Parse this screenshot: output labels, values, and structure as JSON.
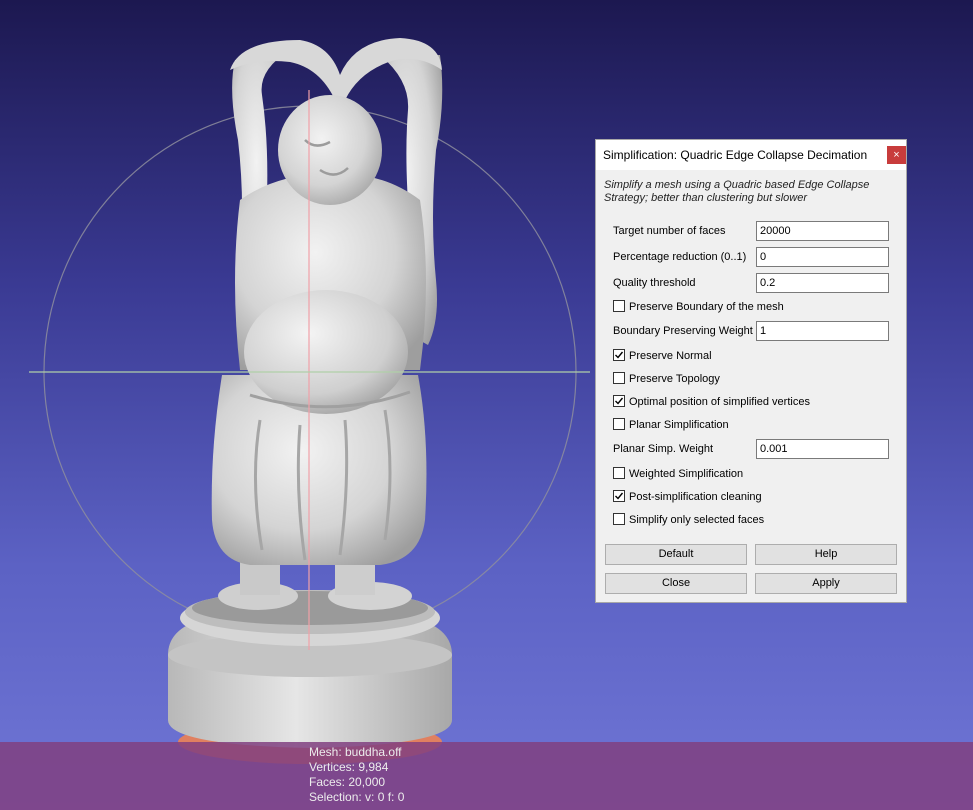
{
  "viewport": {
    "info": {
      "mesh": "Mesh: buddha.off",
      "vertices": "Vertices: 9,984",
      "faces": "Faces: 20,000",
      "selection": "Selection: v: 0 f: 0"
    }
  },
  "dialog": {
    "title": "Simplification: Quadric Edge Collapse Decimation",
    "close_glyph": "×",
    "description": "Simplify a mesh using a Quadric based Edge Collapse Strategy; better than clustering but slower",
    "fields": {
      "target_faces": {
        "label": "Target number of faces",
        "value": "20000"
      },
      "percentage": {
        "label": "Percentage reduction (0..1)",
        "value": "0"
      },
      "quality": {
        "label": "Quality threshold",
        "value": "0.2"
      },
      "boundary_weight": {
        "label": "Boundary Preserving Weight",
        "value": "1"
      },
      "planar_weight": {
        "label": "Planar Simp. Weight",
        "value": "0.001"
      }
    },
    "checks": {
      "preserve_boundary": {
        "label": "Preserve Boundary of the mesh",
        "checked": false
      },
      "preserve_normal": {
        "label": "Preserve Normal",
        "checked": true
      },
      "preserve_topology": {
        "label": "Preserve Topology",
        "checked": false
      },
      "optimal_position": {
        "label": "Optimal position of simplified vertices",
        "checked": true
      },
      "planar_simplification": {
        "label": "Planar Simplification",
        "checked": false
      },
      "weighted_simplification": {
        "label": "Weighted Simplification",
        "checked": false
      },
      "post_cleaning": {
        "label": "Post-simplification cleaning",
        "checked": true
      },
      "selected_only": {
        "label": "Simplify only selected faces",
        "checked": false
      }
    },
    "buttons": {
      "default": "Default",
      "help": "Help",
      "close": "Close",
      "apply": "Apply"
    }
  }
}
